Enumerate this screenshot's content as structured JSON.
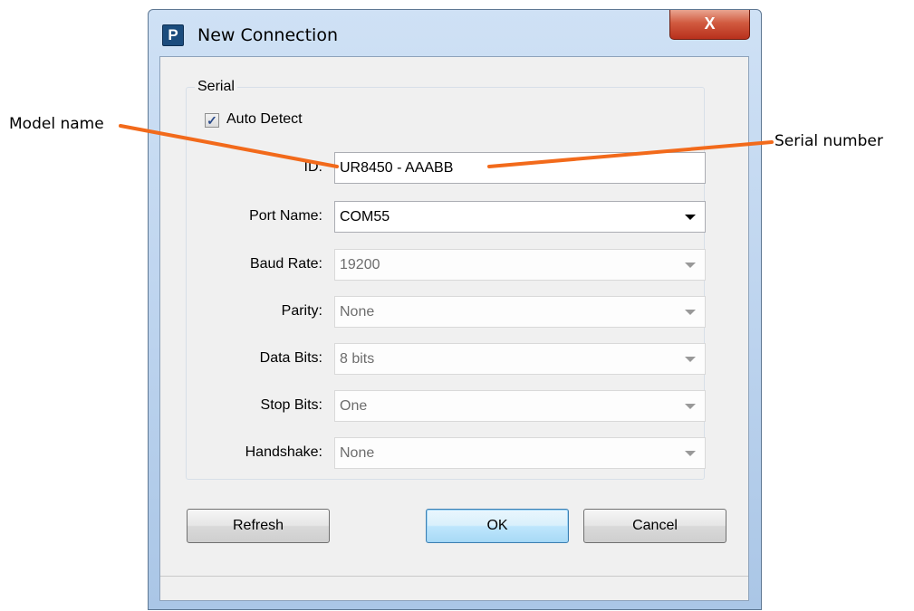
{
  "annotations": {
    "model": "Model name",
    "serial": "Serial number"
  },
  "window": {
    "title": "New Connection",
    "icon_letter": "P",
    "close_glyph": "X"
  },
  "serial_group": {
    "label": "Serial",
    "auto_detect": {
      "label": "Auto Detect",
      "checked": true,
      "check_glyph": "✓"
    },
    "id": {
      "label": "ID:",
      "value": "UR8450 - AAABB"
    },
    "port_name": {
      "label": "Port Name:",
      "value": "COM55"
    },
    "baud_rate": {
      "label": "Baud Rate:",
      "value": "19200"
    },
    "parity": {
      "label": "Parity:",
      "value": "None"
    },
    "data_bits": {
      "label": "Data Bits:",
      "value": "8 bits"
    },
    "stop_bits": {
      "label": "Stop Bits:",
      "value": "One"
    },
    "handshake": {
      "label": "Handshake:",
      "value": "None"
    }
  },
  "buttons": {
    "refresh": "Refresh",
    "ok": "OK",
    "cancel": "Cancel"
  },
  "colors": {
    "leader_line": "#f26a1b",
    "close_button": "#c8432a",
    "title_gradient": "#bcd3ee"
  }
}
